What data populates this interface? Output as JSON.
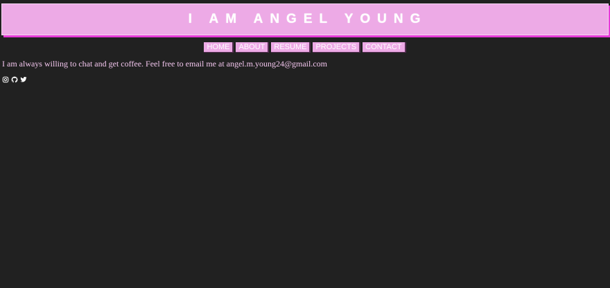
{
  "header": {
    "title": "I AM ANGEL YOUNG"
  },
  "nav": {
    "items": [
      {
        "label": "HOME"
      },
      {
        "label": "ABOUT"
      },
      {
        "label": "RESUME"
      },
      {
        "label": "PROJECTS"
      },
      {
        "label": "CONTACT"
      }
    ]
  },
  "main": {
    "intro_text": "I am always willing to chat and get coffee. Feel free to email me at angel.m.young24@gmail.com"
  },
  "social": {
    "icons": [
      "instagram-icon",
      "github-icon",
      "twitter-icon"
    ]
  },
  "colors": {
    "background": "#212121",
    "accent_pink": "#edaae6",
    "shadow_magenta": "#e63ad8",
    "text_pink": "#f3c6ee",
    "text_white": "#ffffff"
  }
}
